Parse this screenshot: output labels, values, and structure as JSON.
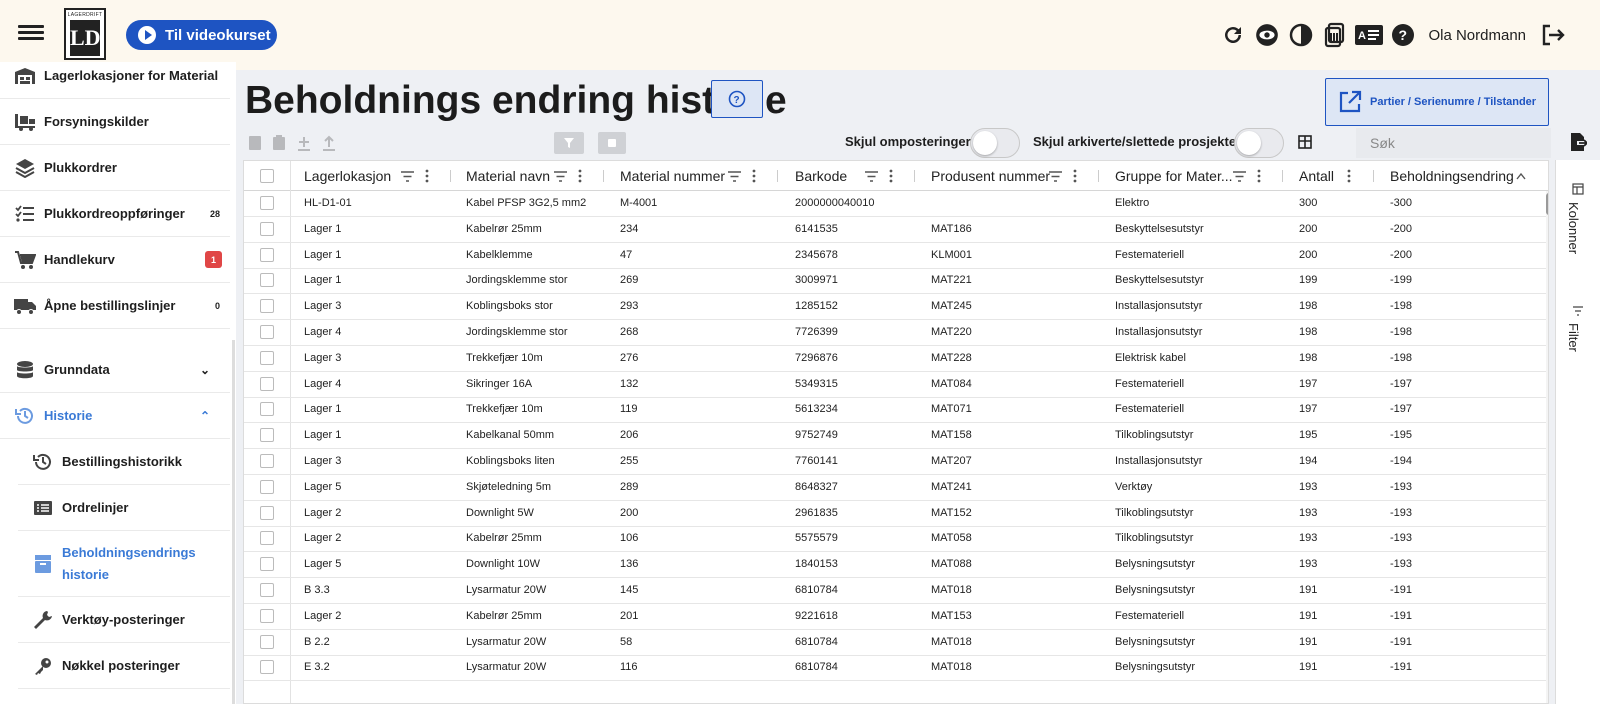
{
  "header": {
    "logo_text": "LAGERDRIFT",
    "logo_mark": "LD",
    "video_button": "Til videokurset",
    "user_name": "Ola Nordmann",
    "icons": [
      "refresh-icon",
      "eye-icon",
      "contrast-icon",
      "clipboard-icon",
      "id-card-icon",
      "help-icon",
      "logout-icon"
    ]
  },
  "sidebar": {
    "items": [
      {
        "label": "Lagerlokasjoner for Material",
        "icon": "warehouse-icon",
        "badge": ""
      },
      {
        "label": "Forsyningskilder",
        "icon": "truck-loading-icon",
        "badge": ""
      },
      {
        "label": "Plukkordrer",
        "icon": "layers-icon",
        "badge": ""
      },
      {
        "label": "Plukkordreoppføringer",
        "icon": "checklist-icon",
        "badge": "28"
      },
      {
        "label": "Handlekurv",
        "icon": "cart-icon",
        "badge": "1"
      },
      {
        "label": "Åpne bestillingslinjer",
        "icon": "delivery-truck-icon",
        "badge": "0"
      },
      {
        "label": "Grunndata",
        "icon": "database-icon",
        "badge": ""
      },
      {
        "label": "Historie",
        "icon": "history-icon",
        "badge": ""
      }
    ],
    "sub_items": [
      {
        "label": "Bestillingshistorikk",
        "icon": "history-icon"
      },
      {
        "label": "Ordrelinjer",
        "icon": "list-icon"
      },
      {
        "label": "Beholdningsendrings historie",
        "icon": "inventory-icon"
      },
      {
        "label": "Verktøy-posteringer",
        "icon": "wrench-icon"
      },
      {
        "label": "Nøkkel posteringer",
        "icon": "key-icon"
      }
    ]
  },
  "page": {
    "title": "Beholdnings endring historie",
    "partier_button": "Partier / Serienumre / Tilstander",
    "toggle1_label": "Skjul omposteringer",
    "toggle2_label": "Skjul arkiverte/slettede prosjekter",
    "search_placeholder": "Søk"
  },
  "grid": {
    "columns": [
      "Lagerlokasjon",
      "Material navn",
      "Material nummer",
      "Barkode",
      "Produsent nummer",
      "Gruppe for Mater...",
      "Antall",
      "Beholdningsendring"
    ],
    "rows": [
      [
        "HL-D1-01",
        "Kabel PFSP 3G2,5 mm2",
        "M-4001",
        "2000000040010",
        "",
        "Elektro",
        "300",
        "-300"
      ],
      [
        "Lager 1",
        "Kabelrør 25mm",
        "234",
        "6141535",
        "MAT186",
        "Beskyttelsesutstyr",
        "200",
        "-200"
      ],
      [
        "Lager 1",
        "Kabelklemme",
        "47",
        "2345678",
        "KLM001",
        "Festemateriell",
        "200",
        "-200"
      ],
      [
        "Lager 1",
        "Jordingsklemme stor",
        "269",
        "3009971",
        "MAT221",
        "Beskyttelsesutstyr",
        "199",
        "-199"
      ],
      [
        "Lager 3",
        "Koblingsboks stor",
        "293",
        "1285152",
        "MAT245",
        "Installasjonsutstyr",
        "198",
        "-198"
      ],
      [
        "Lager 4",
        "Jordingsklemme stor",
        "268",
        "7726399",
        "MAT220",
        "Installasjonsutstyr",
        "198",
        "-198"
      ],
      [
        "Lager 3",
        "Trekkefjær 10m",
        "276",
        "7296876",
        "MAT228",
        "Elektrisk kabel",
        "198",
        "-198"
      ],
      [
        "Lager 4",
        "Sikringer 16A",
        "132",
        "5349315",
        "MAT084",
        "Festemateriell",
        "197",
        "-197"
      ],
      [
        "Lager 1",
        "Trekkefjær 10m",
        "119",
        "5613234",
        "MAT071",
        "Festemateriell",
        "197",
        "-197"
      ],
      [
        "Lager 1",
        "Kabelkanal 50mm",
        "206",
        "9752749",
        "MAT158",
        "Tilkoblingsutstyr",
        "195",
        "-195"
      ],
      [
        "Lager 3",
        "Koblingsboks liten",
        "255",
        "7760141",
        "MAT207",
        "Installasjonsutstyr",
        "194",
        "-194"
      ],
      [
        "Lager 5",
        "Skjøteledning 5m",
        "289",
        "8648327",
        "MAT241",
        "Verktøy",
        "193",
        "-193"
      ],
      [
        "Lager 2",
        "Downlight 5W",
        "200",
        "2961835",
        "MAT152",
        "Tilkoblingsutstyr",
        "193",
        "-193"
      ],
      [
        "Lager 2",
        "Kabelrør 25mm",
        "106",
        "5575579",
        "MAT058",
        "Tilkoblingsutstyr",
        "193",
        "-193"
      ],
      [
        "Lager 5",
        "Downlight 10W",
        "136",
        "1840153",
        "MAT088",
        "Belysningsutstyr",
        "193",
        "-193"
      ],
      [
        "B 3.3",
        "Lysarmatur 20W",
        "145",
        "6810784",
        "MAT018",
        "Belysningsutstyr",
        "191",
        "-191"
      ],
      [
        "Lager 2",
        "Kabelrør 25mm",
        "201",
        "9221618",
        "MAT153",
        "Festemateriell",
        "191",
        "-191"
      ],
      [
        "B 2.2",
        "Lysarmatur 20W",
        "58",
        "6810784",
        "MAT018",
        "Belysningsutstyr",
        "191",
        "-191"
      ],
      [
        "E 3.2",
        "Lysarmatur 20W",
        "116",
        "6810784",
        "MAT018",
        "Belysningsutstyr",
        "191",
        "-191"
      ]
    ]
  },
  "side_panel": {
    "tab1": "Kolonner",
    "tab2": "Filter"
  },
  "colors": {
    "accent": "#1e54c2",
    "topbar": "#fdf8ee",
    "active_link": "#3a7ad6",
    "badge_red": "#e04646"
  }
}
